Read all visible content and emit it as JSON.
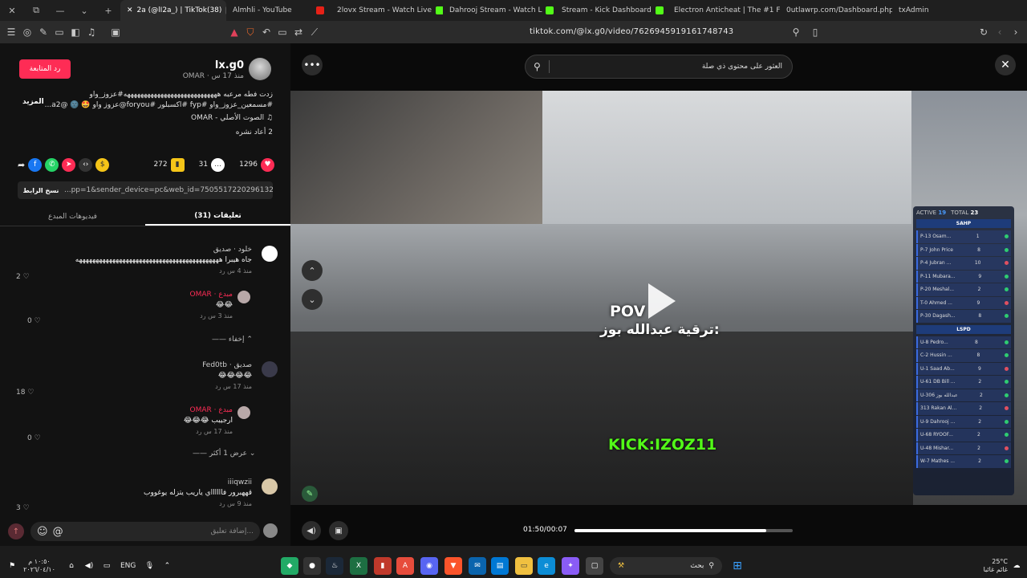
{
  "browser": {
    "tabs": [
      {
        "label": "2a (@lI2a_) | TikTok(38)",
        "active": true
      },
      {
        "label": "Almhli - YouTube",
        "active": false
      },
      {
        "label": "2lovx Stream - Watch Live",
        "active": false
      },
      {
        "label": "Dahrooj Stream - Watch L",
        "active": false
      },
      {
        "label": "Stream - Kick Dashboard",
        "active": false
      },
      {
        "label": "Electron Anticheat | The #1 Fi",
        "active": false
      },
      {
        "label": "0utlawrp.com/Dashboard.php",
        "active": false
      },
      {
        "label": "txAdmin",
        "active": false
      }
    ],
    "url": "tiktok.com/@lx.g0/video/7626945919161748743"
  },
  "post": {
    "follow_label": "رد المتابعة",
    "username": "lx.g0",
    "subline": "OMAR · منذ 17 س",
    "description": "زدت فطه مرعبه ههههههههههههههههههههههههههههه#عزوز_واو #مسمعين_عزوز_واو #fyp #اكسبلور #foryou@عزوز واو 🤩 🌚 @a2...",
    "more_label": "المزيد",
    "sound": "♫ الصوت الأصلي - OMAR",
    "shares": "2 أعاد نشره",
    "likes": "1296",
    "comments_count": "31",
    "saves": "272",
    "copy_text": "...pp=1&sender_device=pc&web_id=7505517220296132151",
    "copy_label": "نسخ الرابط",
    "tab_comments": "(31) تعليقات",
    "tab_creator_videos": "فيديوهات المبدع"
  },
  "comments": [
    {
      "name": "خلود · صديق",
      "text": "جاه هيبرا هههههههههههههههههههههههههههههههههههههههههههه",
      "meta": "منذ 4 س    رد",
      "likes": "2"
    },
    {
      "name": "OMAR · مبدع",
      "text": "😂😂",
      "meta": "منذ 3 س    رد",
      "likes": "0"
    },
    {
      "name": "Fed0tb · صديق",
      "text": "😂😂😂😂",
      "meta": "منذ 17 س    رد",
      "likes": "18"
    },
    {
      "name": "OMAR · مبدع",
      "text": "ارجيبب 😂😂😂",
      "meta": "منذ 17 س    رد",
      "likes": "0"
    },
    {
      "name": "iiiqwzii",
      "text": "قههبرور فااااااي ياريب يتزله يوغووب",
      "meta": "منذ 9 س    رد",
      "likes": "3"
    }
  ],
  "reply_controls": {
    "hide": "إخفاء",
    "show_more": "عرض 1 أكثر"
  },
  "comment_input_placeholder": "إضافة تعليق...",
  "search_placeholder": "العثور على محتوى ذي صلة",
  "video": {
    "pov": "POV",
    "caption": ":ترقية عبدالله بوز",
    "kick": "KICK:IZOZ11",
    "time": "01:50/00:07",
    "progress": 0.88
  },
  "roster": {
    "active_label": "ACTIVE",
    "active": "19",
    "total_label": "TOTAL",
    "total": "23",
    "sections": [
      {
        "name": "SAHP",
        "rows": [
          {
            "name": "P-13 Osam...",
            "num": "1"
          },
          {
            "name": "P-7 John Price",
            "num": "8"
          },
          {
            "name": "P-4 Jubran ...",
            "num": "10"
          },
          {
            "name": "P-11 Mubara...",
            "num": "9"
          },
          {
            "name": "P-20 Meshal...",
            "num": "2"
          },
          {
            "name": "T-0 Ahmed ...",
            "num": "9"
          },
          {
            "name": "P-30 Dagash...",
            "num": "8"
          }
        ]
      },
      {
        "name": "LSPD",
        "rows": [
          {
            "name": "U-8 Pedro...",
            "num": "8"
          },
          {
            "name": "C-2 Hussin ...",
            "num": "8"
          },
          {
            "name": "U-1 Saad Ab...",
            "num": "9"
          },
          {
            "name": "U-61 DB Bill ...",
            "num": "2"
          },
          {
            "name": "U-306 عبدالله بوز",
            "num": "2"
          },
          {
            "name": "313 Rakan Al...",
            "num": "2"
          },
          {
            "name": "U-9 Dahrooj ...",
            "num": "2"
          },
          {
            "name": "U-68 RYOOF...",
            "num": "2"
          },
          {
            "name": "U-48 Mishar...",
            "num": "2"
          },
          {
            "name": "W-7 Mathes ...",
            "num": "2"
          }
        ]
      }
    ]
  },
  "taskbar": {
    "time": "١٠:٥٠ م",
    "date": "٢٠٢٦/٠٤/١٠",
    "lang": "ENG",
    "search": "بحث",
    "weather_temp": "25°C",
    "weather_desc": "غائم غائبا"
  },
  "colors": {
    "accent": "#fe2c55",
    "kick_green": "#53fc18",
    "bg_dark": "#121212"
  }
}
